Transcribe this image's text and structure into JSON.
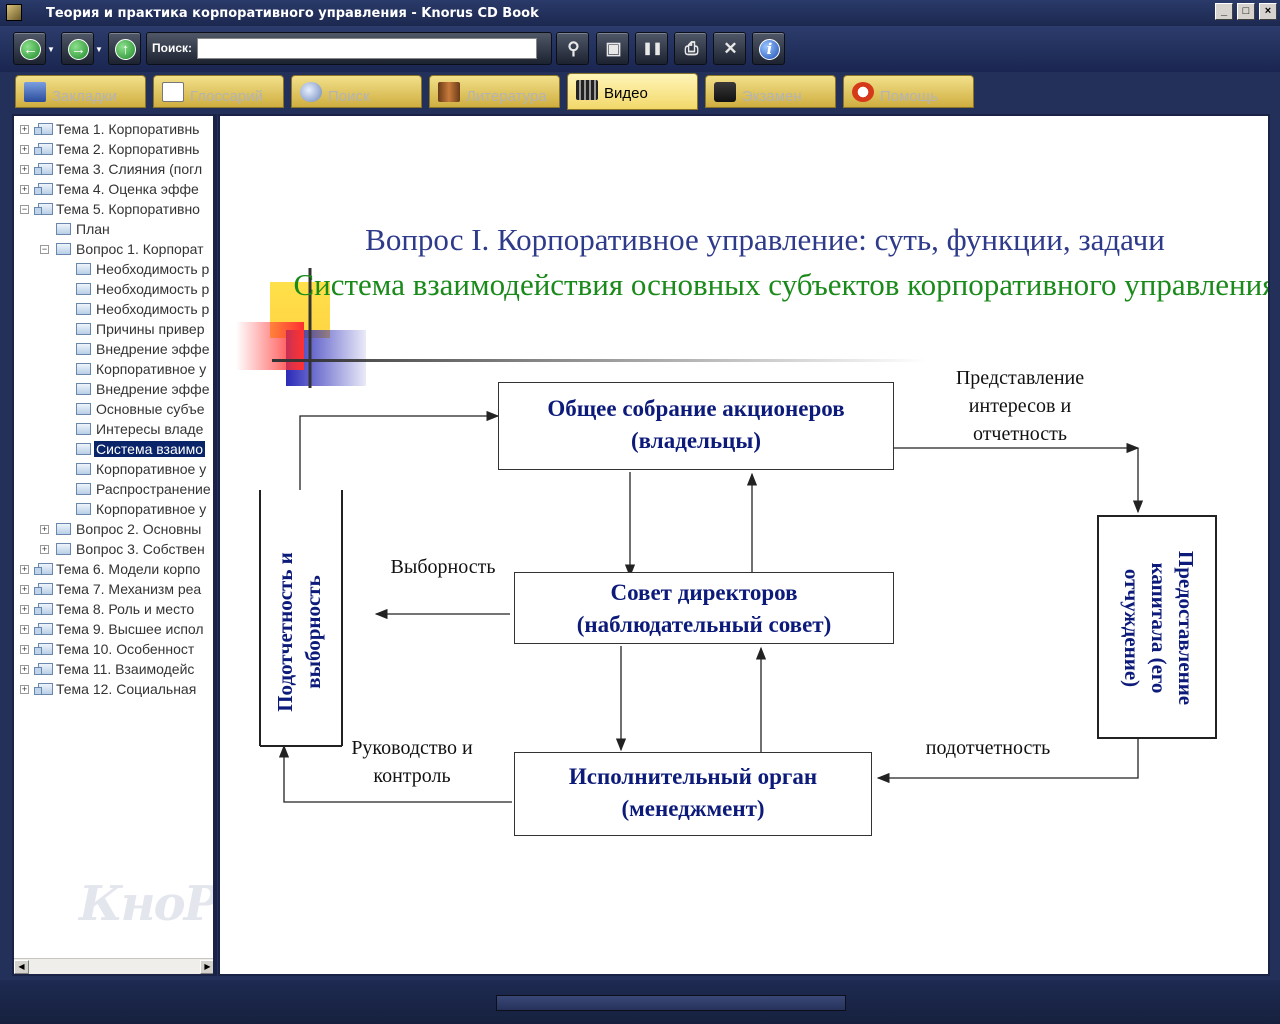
{
  "window": {
    "title": "Теория и практика корпоративного управления - Knorus CD Book",
    "controls": [
      "_",
      "□",
      "×"
    ]
  },
  "toolbar": {
    "search_label": "Поиск:",
    "search_value": "",
    "buttons": [
      {
        "name": "back",
        "icon": "arrow-left-icon",
        "glyph": "←"
      },
      {
        "name": "forward",
        "icon": "arrow-right-icon",
        "glyph": "→"
      },
      {
        "name": "up",
        "icon": "arrow-up-icon",
        "glyph": "↑"
      },
      {
        "name": "find",
        "icon": "magnifier-icon",
        "glyph": "⚲"
      },
      {
        "name": "screen",
        "icon": "monitor-icon",
        "glyph": "▣"
      },
      {
        "name": "bookmark",
        "icon": "book-icon",
        "glyph": "❚❚"
      },
      {
        "name": "print",
        "icon": "printer-icon",
        "glyph": "⎙"
      },
      {
        "name": "tools",
        "icon": "tools-icon",
        "glyph": "✕"
      },
      {
        "name": "info",
        "icon": "info-icon",
        "glyph": "i"
      }
    ]
  },
  "tabs": [
    {
      "label": "Закладки",
      "icon": "book-icon",
      "active": false
    },
    {
      "label": "Глоссарий",
      "icon": "abc-icon",
      "active": false
    },
    {
      "label": "Поиск",
      "icon": "magnifier-icon",
      "active": false
    },
    {
      "label": "Литература",
      "icon": "books-icon",
      "active": false
    },
    {
      "label": "Видео",
      "icon": "film-icon",
      "active": true
    },
    {
      "label": "Экзамен",
      "icon": "graduation-cap-icon",
      "active": false
    },
    {
      "label": "Помощь",
      "icon": "lifebuoy-icon",
      "active": false
    }
  ],
  "tree": [
    {
      "label": "Тема 1. Корпоративнь",
      "level": 0,
      "expanded": false
    },
    {
      "label": "Тема 2. Корпоративнь",
      "level": 0,
      "expanded": false
    },
    {
      "label": "Тема 3. Слияния (погл",
      "level": 0,
      "expanded": false
    },
    {
      "label": "Тема 4. Оценка эффе",
      "level": 0,
      "expanded": false
    },
    {
      "label": "Тема 5. Корпоративно",
      "level": 0,
      "expanded": true
    },
    {
      "label": "План",
      "level": 1,
      "expanded": null
    },
    {
      "label": "Вопрос 1. Корпорат",
      "level": 1,
      "expanded": true
    },
    {
      "label": "Необходимость р",
      "level": 2,
      "expanded": null
    },
    {
      "label": "Необходимость р",
      "level": 2,
      "expanded": null
    },
    {
      "label": "Необходимость р",
      "level": 2,
      "expanded": null
    },
    {
      "label": "Причины привер",
      "level": 2,
      "expanded": null
    },
    {
      "label": "Внедрение эффе",
      "level": 2,
      "expanded": null
    },
    {
      "label": "Корпоративное у",
      "level": 2,
      "expanded": null
    },
    {
      "label": "Внедрение эффе",
      "level": 2,
      "expanded": null
    },
    {
      "label": "Основные субъе",
      "level": 2,
      "expanded": null
    },
    {
      "label": "Интересы владе",
      "level": 2,
      "expanded": null
    },
    {
      "label": "Система взаимо",
      "level": 2,
      "expanded": null,
      "selected": true
    },
    {
      "label": "Корпоративное у",
      "level": 2,
      "expanded": null
    },
    {
      "label": "Распространение",
      "level": 2,
      "expanded": null
    },
    {
      "label": "Корпоративное у",
      "level": 2,
      "expanded": null
    },
    {
      "label": "Вопрос 2. Основны",
      "level": 1,
      "expanded": false
    },
    {
      "label": "Вопрос 3. Собствен",
      "level": 1,
      "expanded": false
    },
    {
      "label": "Тема 6. Модели корпо",
      "level": 0,
      "expanded": false
    },
    {
      "label": "Тема 7. Механизм реа",
      "level": 0,
      "expanded": false
    },
    {
      "label": "Тема 8. Роль и место",
      "level": 0,
      "expanded": false
    },
    {
      "label": "Тема 9. Высшее испол",
      "level": 0,
      "expanded": false
    },
    {
      "label": "Тема 10. Особенност",
      "level": 0,
      "expanded": false
    },
    {
      "label": "Тема 11. Взаимодейс",
      "level": 0,
      "expanded": false
    },
    {
      "label": "Тема 12. Социальная",
      "level": 0,
      "expanded": false
    }
  ],
  "watermark": "КноРус",
  "slide": {
    "title": "Вопрос I. Корпоративное управление: суть, функции, задачи",
    "subtitle": "Система взаимодействия основных субъектов корпоративного управления",
    "boxes": {
      "shareholders_line1": "Общее собрание акционеров",
      "shareholders_line2": "(владельцы)",
      "board_line1": "Совет директоров",
      "board_line2": "(наблюдательный совет)",
      "executive_line1": "Исполнительный орган",
      "executive_line2": "(менеджмент)",
      "left_vertical_line1": "Подотчетность и",
      "left_vertical_line2": "выборность",
      "right_vertical_line1": "Предоставление",
      "right_vertical_line2": "капитала (его",
      "right_vertical_line3": "отчуждение)"
    },
    "labels": {
      "representation_line1": "Представление",
      "representation_line2": "интересов и",
      "representation_line3": "отчетность",
      "electivity": "Выборность",
      "management_line1": "Руководство и",
      "management_line2": "контроль",
      "accountability": "подотчетность"
    }
  },
  "colors": {
    "title": "#2e3a8a",
    "subtitle": "#1a8a1a",
    "box_text": "#0c1a7a",
    "tab_bg": "#f2d86a",
    "window_bg": "#22305a"
  }
}
